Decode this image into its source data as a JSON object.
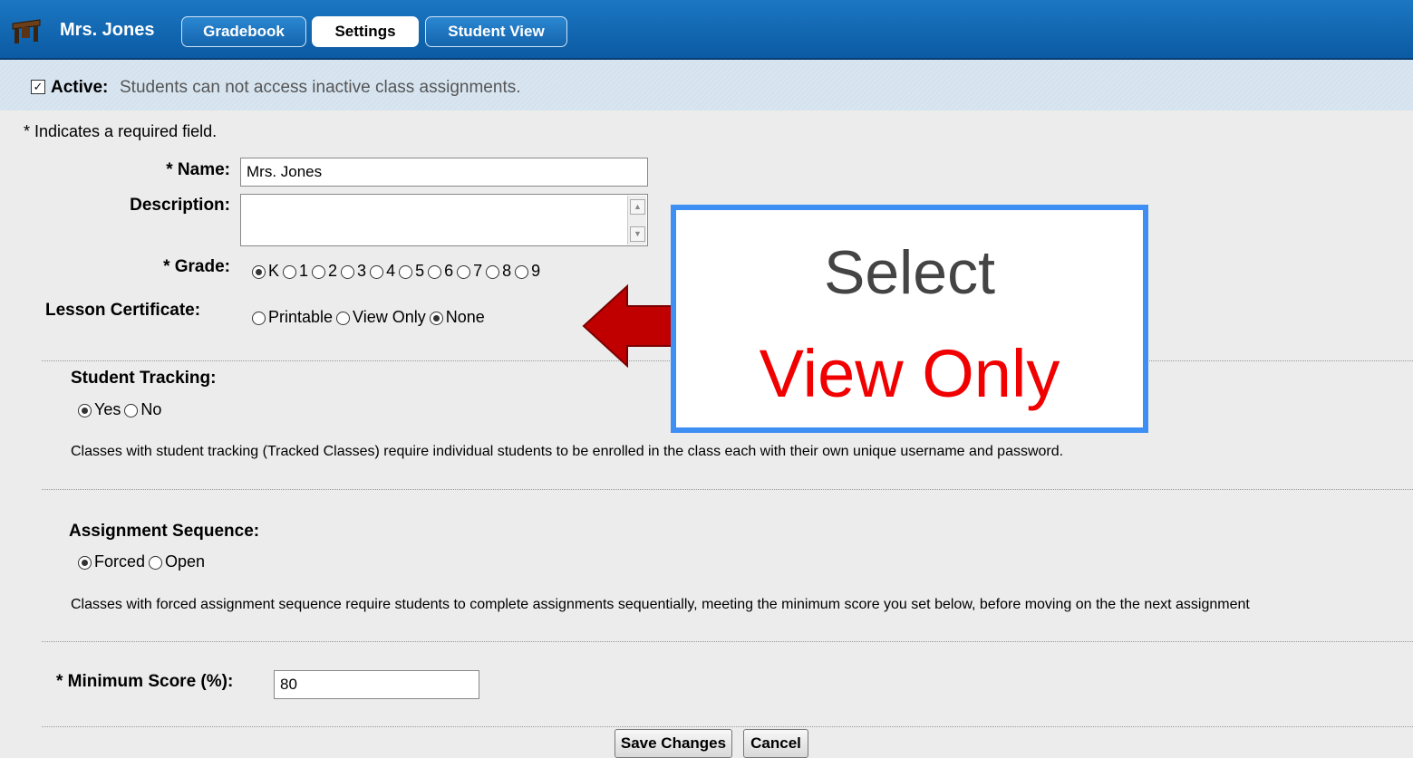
{
  "header": {
    "teacher_name": "Mrs. Jones",
    "tabs": [
      {
        "label": "Gradebook",
        "active": false
      },
      {
        "label": "Settings",
        "active": true
      },
      {
        "label": "Student View",
        "active": false
      }
    ]
  },
  "active_bar": {
    "checked": true,
    "label": "Active:",
    "text": "Students can not access inactive class assignments."
  },
  "form": {
    "required_note": "* Indicates a required field.",
    "name_label": "* Name:",
    "name_value": "Mrs. Jones",
    "description_label": "Description:",
    "description_value": "",
    "grade_label": "* Grade:",
    "grade_options": [
      "K",
      "1",
      "2",
      "3",
      "4",
      "5",
      "6",
      "7",
      "8",
      "9"
    ],
    "grade_selected": "K",
    "certificate_label": "Lesson Certificate:",
    "certificate_options": [
      "Printable",
      "View Only",
      "None"
    ],
    "certificate_selected": "None",
    "tracking_title": "Student Tracking:",
    "tracking_options": [
      "Yes",
      "No"
    ],
    "tracking_selected": "Yes",
    "tracking_desc": "Classes with student tracking (Tracked Classes) require individual students to be enrolled in the class each with their own unique username and password.",
    "sequence_title": "Assignment Sequence:",
    "sequence_options": [
      "Forced",
      "Open"
    ],
    "sequence_selected": "Forced",
    "sequence_desc": "Classes with forced assignment sequence require students to complete assignments sequentially, meeting the minimum score you set below, before moving on the the next assignment",
    "min_score_label": "* Minimum Score (%):",
    "min_score_value": "80"
  },
  "buttons": {
    "save": "Save Changes",
    "cancel": "Cancel"
  },
  "callout": {
    "line1": "Select",
    "line2": "View Only"
  },
  "colors": {
    "header_blue": "#0b5aa3",
    "callout_border": "#3e8ff3",
    "callout_red": "#f10000",
    "arrow_red": "#c00000"
  }
}
